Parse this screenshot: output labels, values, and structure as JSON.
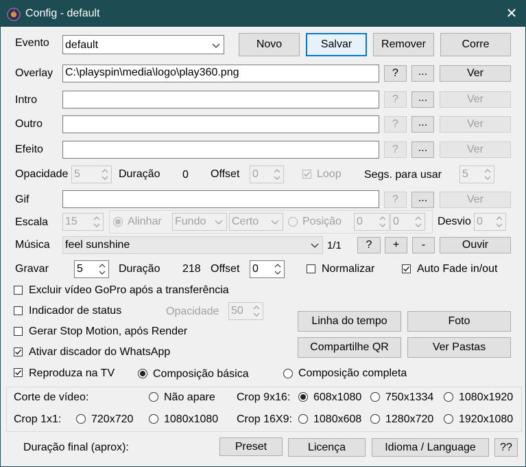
{
  "window": {
    "title": "Config - default",
    "close_glyph": "✕"
  },
  "evento": {
    "label": "Evento",
    "value": "default",
    "buttons": {
      "novo": "Novo",
      "salvar": "Salvar",
      "remover": "Remover",
      "corre": "Corre"
    }
  },
  "files": [
    {
      "label": "Overlay",
      "value": "C:\\playspin\\media\\logo\\play360.png",
      "help": "?",
      "browse": "...",
      "view": "Ver",
      "enabled": true
    },
    {
      "label": "Intro",
      "value": "",
      "help": "?",
      "browse": "...",
      "view": "Ver",
      "enabled": false
    },
    {
      "label": "Outro",
      "value": "",
      "help": "?",
      "browse": "...",
      "view": "Ver",
      "enabled": false
    },
    {
      "label": "Efeito",
      "value": "",
      "help": "?",
      "browse": "...",
      "view": "Ver",
      "enabled": false
    }
  ],
  "row_opacity": {
    "opacidade_label": "Opacidade",
    "opacidade_value": "5",
    "duracao_label": "Duração",
    "duracao_value": "0",
    "offset_label": "Offset",
    "offset_value": "0",
    "loop_label": "Loop",
    "loop_checked": true,
    "segs_label": "Segs. para usar",
    "segs_value": "5"
  },
  "gif": {
    "label": "Gif",
    "value": "",
    "help": "?",
    "browse": "...",
    "view": "Ver"
  },
  "escala": {
    "label": "Escala",
    "value": "15",
    "alinhar_label": "Alinhar",
    "fundo_value": "Fundo",
    "certo_value": "Certo",
    "posicao_label": "Posição",
    "pos_x": "0",
    "pos_y": "0",
    "desvio_label": "Desvio",
    "desvio_value": "0"
  },
  "musica": {
    "label": "Música",
    "value": "feel sunshine",
    "counter": "1/1",
    "help": "?",
    "add": "+",
    "remove": "-",
    "listen": "Ouvir"
  },
  "gravar": {
    "label": "Gravar",
    "value": "5",
    "duracao_label": "Duração",
    "duracao_value": "218",
    "offset_label": "Offset",
    "offset_value": "0",
    "normalizar_label": "Normalizar",
    "normalizar_checked": false,
    "autofade_label": "Auto Fade in/out",
    "autofade_checked": true
  },
  "options": {
    "excluir_label": "Excluir vídeo GoPro após a transferência",
    "excluir_checked": false,
    "indicador_label": "Indicador de status",
    "indicador_checked": false,
    "ind_opacidade_label": "Opacidade",
    "ind_opacidade_value": "50",
    "stopmotion_label": "Gerar Stop Motion, após Render",
    "stopmotion_checked": false,
    "whatsapp_label": "Ativar discador do WhatsApp",
    "whatsapp_checked": true,
    "tv_label": "Reproduza na TV",
    "tv_checked": true,
    "comp_basica_label": "Composição básica",
    "comp_completa_label": "Composição completa",
    "comp_selected": "basica"
  },
  "side_buttons": {
    "timeline": "Linha do tempo",
    "foto": "Foto",
    "qr": "Compartilhe QR",
    "pastas": "Ver Pastas"
  },
  "crop": {
    "corte_label": "Corte de vídeo:",
    "nao_apare": "Não apare",
    "crop916_label": "Crop 9x16:",
    "r608": "608x1080",
    "r750": "750x1334",
    "r1080a": "1080x1920",
    "crop11_label": "Crop 1x1:",
    "r720": "720x720",
    "r1080b": "1080x1080",
    "crop169_label": "Crop 16X9:",
    "r1080c": "1080x608",
    "r1280": "1280x720",
    "r1920": "1920x1080"
  },
  "footer": {
    "duracao_final": "Duração final (aprox):",
    "preset": "Preset",
    "licenca": "Licença",
    "idioma": "Idioma / Language",
    "help": "??"
  },
  "colors": {
    "titlebar": "#1d4d52",
    "accent": "#0078d7",
    "window_bg": "#f0f0f0"
  }
}
